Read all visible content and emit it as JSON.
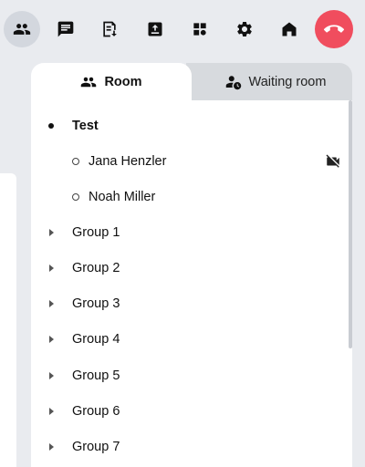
{
  "toolbar": {
    "buttons": [
      {
        "icon": "people-icon",
        "active": true
      },
      {
        "icon": "chat-icon"
      },
      {
        "icon": "notes-icon"
      },
      {
        "icon": "upload-icon"
      },
      {
        "icon": "apps-grid-icon"
      },
      {
        "icon": "gear-icon"
      },
      {
        "icon": "home-icon"
      },
      {
        "icon": "hang-up-icon",
        "color": "#f04d5e"
      }
    ]
  },
  "tabs": {
    "room": {
      "label": "Room",
      "icon": "people-icon"
    },
    "waiting": {
      "label": "Waiting room",
      "icon": "waiting-room-icon"
    }
  },
  "room": {
    "name": "Test",
    "participants": [
      {
        "name": "Jana Henzler",
        "status_icon": "video-off-icon"
      },
      {
        "name": "Noah Miller"
      }
    ],
    "groups": [
      {
        "label": "Group 1"
      },
      {
        "label": "Group 2"
      },
      {
        "label": "Group 3"
      },
      {
        "label": "Group 4"
      },
      {
        "label": "Group 5"
      },
      {
        "label": "Group 6"
      },
      {
        "label": "Group 7"
      }
    ]
  },
  "colors": {
    "background": "#e9ebef",
    "active_button": "#d3d7de",
    "hang_up": "#f04d5e",
    "inactive_tab": "#d7dade"
  }
}
